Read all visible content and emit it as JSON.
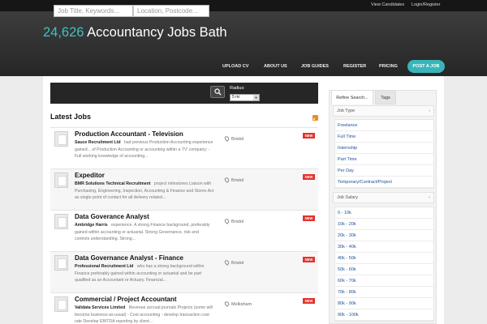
{
  "topbar": {
    "links": [
      "View Candidates",
      "Login/Register"
    ]
  },
  "header": {
    "count": "24,626",
    "title": "Accountancy Jobs Bath"
  },
  "nav": {
    "items": [
      "UPLOAD CV",
      "ABOUT US",
      "JOB GUIDES",
      "REGISTER",
      "PRICING"
    ],
    "post_job": "POST A JOB"
  },
  "search": {
    "keywords_placeholder": "Job Title, Keywords...",
    "location_placeholder": "Location, Postcode...",
    "radius_label": "Radius:",
    "radius_value": "5 mi"
  },
  "latest": {
    "title": "Latest Jobs"
  },
  "jobs": [
    {
      "title": "Production Accountant - Television",
      "company": "Sauce Recruitment Ltd",
      "snippet": "had previous Production Accounting experience gained... of Production Accounting or accounting within a TV' company; - Full working knowledge of accounting...",
      "location": "Bristol",
      "badge": "NEW"
    },
    {
      "title": "Expeditor",
      "company": "BMR Solutions Technical Recruitment",
      "snippet": "project milestones Liaison with Purchasing, Engineering, Inspection, Accounting & Finance and Stores Act as single point of contact for all delivery related...",
      "location": "Bristol",
      "badge": "NEW"
    },
    {
      "title": "Data Goverance Analyst",
      "company": "Ambridge Harris",
      "snippet": "experience. A strong Finance background, preferably gained within accounting or actuarial. Strong Governance, risk and controls understanding. Strong...",
      "location": "Bristol",
      "badge": "NEW"
    },
    {
      "title": "Data Governance Analyst - Finance",
      "company": "Professional Recruitment Ltd",
      "snippet": "who has a strong background within Finance preferably gained within accounting or actuarial and be part qualified as an Accountant or Actuary. Financial...",
      "location": "Bristol",
      "badge": "NEW"
    },
    {
      "title": "Commercial / Project Accountant",
      "company": "Validata Services Limited",
      "snippet": "Revenue accrual journals Projects (some will become business-as-usual) - Cost accounting - develop transaction cost rate Develop EBITDA reporting by client...",
      "location": "Melksham",
      "badge": "NEW"
    }
  ],
  "sidebar": {
    "tabs": [
      "Refine Search...",
      "Tags"
    ],
    "job_type_head": "Job Type",
    "job_types": [
      "Freelance",
      "Full Time",
      "Internship",
      "Part Time",
      "Per Day",
      "Temporary/Contract/Project"
    ],
    "job_salary_head": "Job Salary",
    "salaries": [
      "0 - 10k",
      "10k - 20k",
      "20k - 30k",
      "30k - 40k",
      "40k - 50k",
      "50k - 60k",
      "60k - 70k",
      "70k - 80k",
      "80k - 90k",
      "90k - 100k"
    ]
  }
}
